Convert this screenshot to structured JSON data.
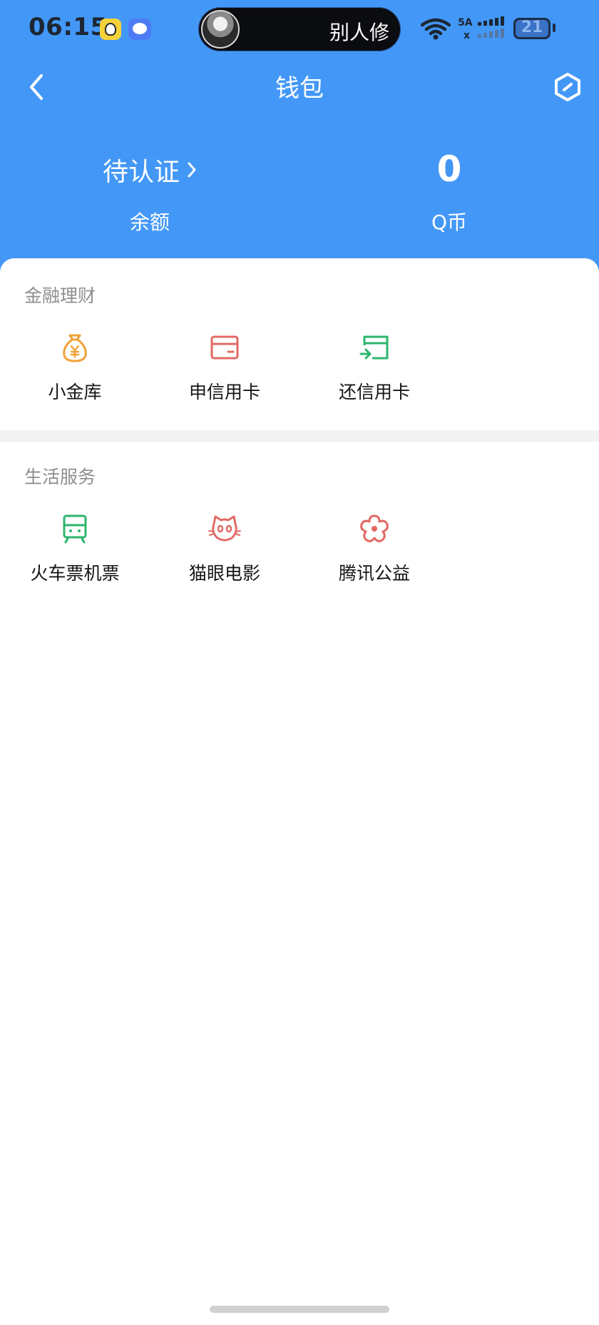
{
  "status_bar": {
    "time": "06:15",
    "island_text": "别人修",
    "battery": "21"
  },
  "nav": {
    "title": "钱包",
    "back_icon": "chevron-left-icon",
    "settings_icon": "hexagon-settings-icon"
  },
  "balance": {
    "left_value": "待认证",
    "left_label": "余额",
    "right_value": "0",
    "right_label": "Q币"
  },
  "finance": {
    "title": "金融理财",
    "items": [
      {
        "label": "小金库",
        "icon": "money-bag-icon",
        "color": "#F2A23A"
      },
      {
        "label": "申信用卡",
        "icon": "credit-card-icon",
        "color": "#E26A64"
      },
      {
        "label": "还信用卡",
        "icon": "card-repay-icon",
        "color": "#2DB56E"
      }
    ]
  },
  "life": {
    "title": "生活服务",
    "items": [
      {
        "label": "火车票机票",
        "icon": "train-icon",
        "color": "#2DB56E"
      },
      {
        "label": "猫眼电影",
        "icon": "cat-icon",
        "color": "#E26A64"
      },
      {
        "label": "腾讯公益",
        "icon": "flower-icon",
        "color": "#E26A64"
      }
    ]
  },
  "colors": {
    "header_bg": "#4398F7",
    "panel_bg": "#FFFFFF",
    "section_title": "#8E8E8E"
  }
}
